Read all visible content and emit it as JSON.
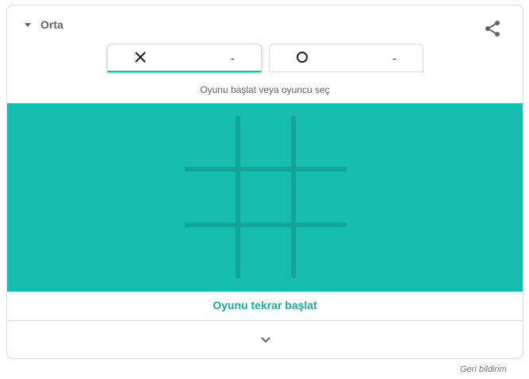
{
  "header": {
    "difficulty_label": "Orta",
    "difficulty_icon": "caret-down-icon",
    "share_icon": "share-icon"
  },
  "players": [
    {
      "symbol": "×",
      "symbol_name": "x-mark-icon",
      "score": "-",
      "active": true
    },
    {
      "symbol": "○",
      "symbol_name": "o-mark-icon",
      "score": "-",
      "active": false
    }
  ],
  "instruction": "Oyunu başlat veya oyuncu seç",
  "board": {
    "rows": 3,
    "cols": 3,
    "cells": [
      "",
      "",
      "",
      "",
      "",
      "",
      "",
      "",
      ""
    ]
  },
  "restart_label": "Oyunu tekrar başlat",
  "expand_icon": "chevron-down-icon",
  "feedback_label": "Geri bildirim",
  "colors": {
    "board_bg": "#16bcad",
    "grid_line": "#10a596",
    "accent_text": "#1aa99b"
  }
}
